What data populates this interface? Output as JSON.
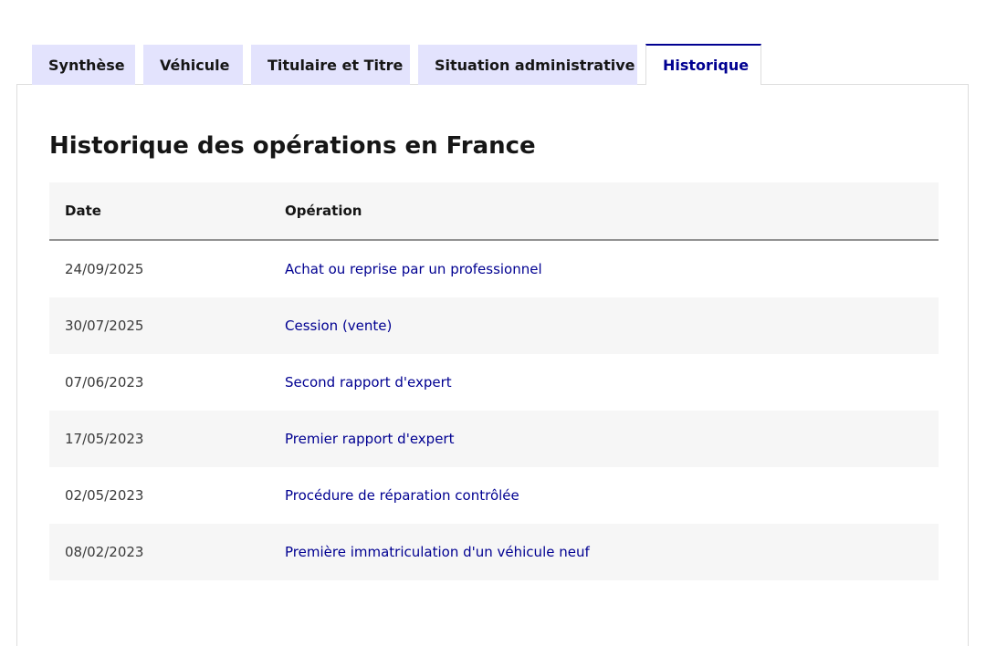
{
  "tabs": [
    {
      "label": "Synthèse"
    },
    {
      "label": "Véhicule"
    },
    {
      "label": "Titulaire et Titre"
    },
    {
      "label": "Situation administrative"
    },
    {
      "label": "Historique"
    }
  ],
  "panel": {
    "title": "Historique des opérations en France"
  },
  "table": {
    "headers": {
      "date": "Date",
      "operation": "Opération"
    },
    "rows": [
      {
        "date": "24/09/2025",
        "operation": "Achat ou reprise par un professionnel"
      },
      {
        "date": "30/07/2025",
        "operation": "Cession (vente)"
      },
      {
        "date": "07/06/2023",
        "operation": "Second rapport d'expert"
      },
      {
        "date": "17/05/2023",
        "operation": "Premier rapport d'expert"
      },
      {
        "date": "02/05/2023",
        "operation": "Procédure de réparation contrôlée"
      },
      {
        "date": "08/02/2023",
        "operation": "Première immatriculation d'un véhicule neuf"
      }
    ]
  },
  "colors": {
    "accent": "#000091",
    "tab_background": "#e3e3fd",
    "row_alt": "#f6f6f6"
  }
}
